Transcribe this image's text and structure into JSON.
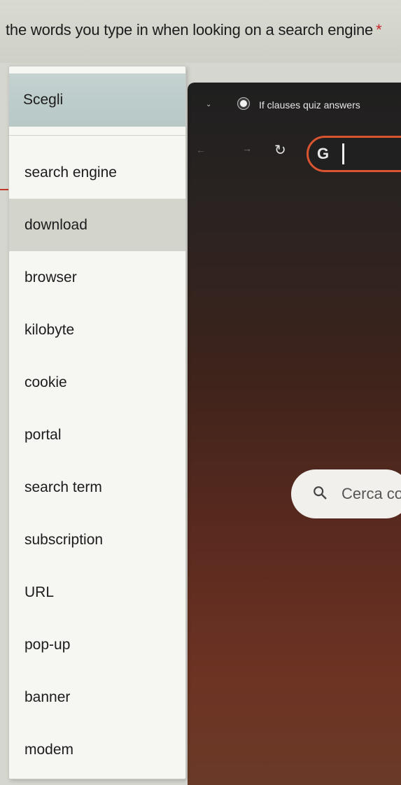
{
  "question": {
    "text": "the words you type in when looking on a search engine",
    "required_marker": "*"
  },
  "browser": {
    "tab_title": "If clauses quiz answers",
    "omnibox_text": "G",
    "search_placeholder": "Cerca co"
  },
  "dropdown": {
    "placeholder": "Scegli",
    "highlighted_index": 1,
    "options": [
      "search engine",
      "download",
      "browser",
      "kilobyte",
      "cookie",
      "portal",
      "search term",
      "subscription",
      "URL",
      "pop-up",
      "banner",
      "modem"
    ]
  }
}
